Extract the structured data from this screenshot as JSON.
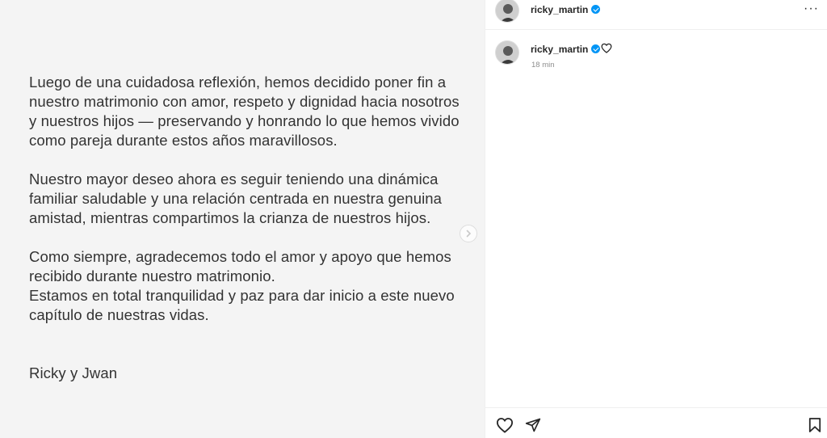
{
  "post": {
    "paragraphs": [
      "Luego de una cuidadosa reflexión, hemos decidido poner fin a nuestro matrimonio con amor, respeto y dignidad hacia nosotros y nuestros hijos — preservando y honrando lo que hemos vivido como pareja durante estos años maravillosos.",
      "Nuestro mayor deseo ahora es seguir teniendo una dinámica familiar saludable y una relación centrada en nuestra genuina amistad, mientras compartimos la crianza de nuestros hijos.",
      "Como siempre, agradecemos todo el amor y apoyo que hemos recibido durante nuestro matrimonio.",
      "Estamos en total tranquilidad y paz para dar inicio a este nuevo capítulo de nuestras vidas.",
      "Ricky y Jwan"
    ],
    "next_icon": "chevron-right-icon"
  },
  "header": {
    "username": "ricky_martin",
    "verified_icon": "verified-badge-icon",
    "more_icon": "more-options-icon",
    "more_label": "···"
  },
  "caption": {
    "username": "ricky_martin",
    "time": "18 min"
  },
  "actions": {
    "like_icon": "heart-icon",
    "share_icon": "paper-plane-icon",
    "save_icon": "bookmark-icon"
  },
  "colors": {
    "verified": "#0095f6",
    "text": "#262626",
    "muted": "#8e8e8e"
  }
}
